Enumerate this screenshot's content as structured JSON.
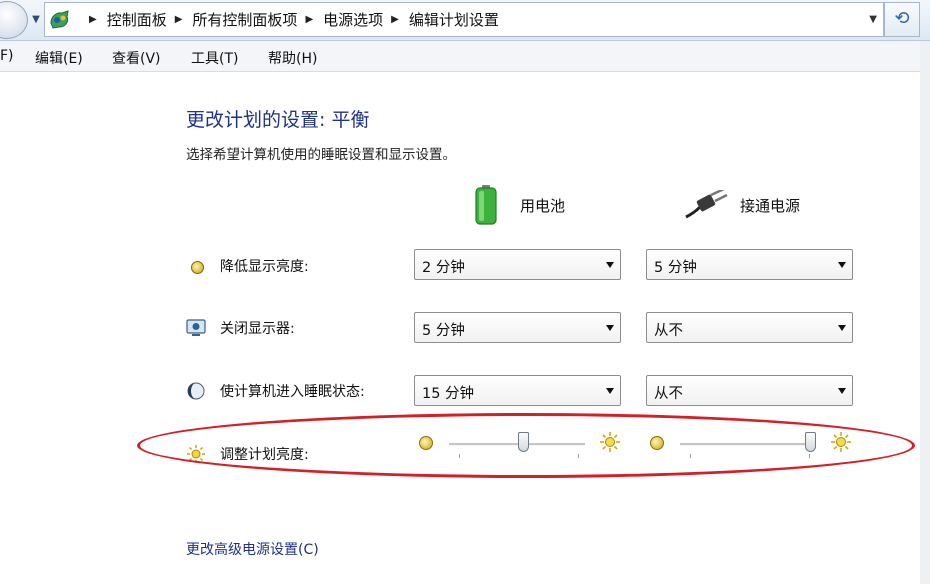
{
  "address_bar": {
    "breadcrumbs": [
      "控制面板",
      "所有控制面板项",
      "电源选项",
      "编辑计划设置"
    ]
  },
  "menu": {
    "file_partial": "F)",
    "edit": "编辑(E)",
    "view": "查看(V)",
    "tools": "工具(T)",
    "help": "帮助(H)"
  },
  "page": {
    "title": "更改计划的设置: 平衡",
    "subtitle": "选择希望计算机使用的睡眠设置和显示设置。"
  },
  "columns": {
    "battery": "用电池",
    "plugged_in": "接通电源"
  },
  "settings": [
    {
      "label": "降低显示亮度:",
      "battery": "2 分钟",
      "plugged": "5 分钟",
      "icon": "dim-brightness-icon"
    },
    {
      "label": "关闭显示器:",
      "battery": "5 分钟",
      "plugged": "从不",
      "icon": "monitor-off-icon"
    },
    {
      "label": "使计算机进入睡眠状态:",
      "battery": "15 分钟",
      "plugged": "从不",
      "icon": "sleep-moon-icon"
    }
  ],
  "brightness": {
    "label": "调整计划亮度:",
    "battery_level": 0.55,
    "plugged_level": 1.0
  },
  "links": {
    "advanced": "更改高级电源设置(C)"
  },
  "colors": {
    "title_blue": "#1e3287",
    "highlight_red": "#d51f26"
  }
}
